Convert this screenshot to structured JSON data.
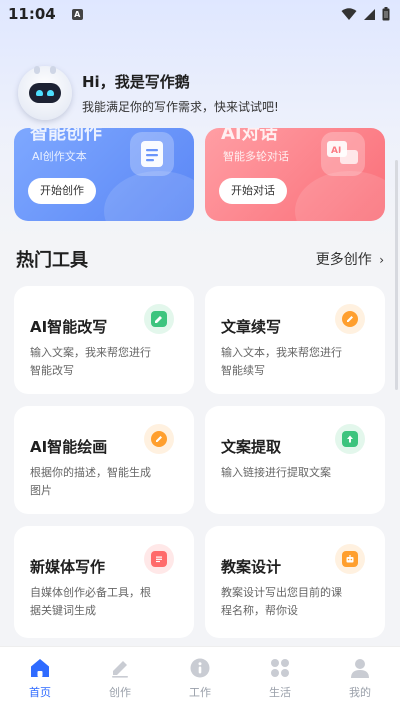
{
  "status_bar": {
    "time": "11:04",
    "notification_glyph": "A"
  },
  "greeting": {
    "title": "Hi，我是写作鹅",
    "subtitle": "我能满足你的写作需求，快来试试吧!"
  },
  "features": [
    {
      "title": "智能创作",
      "subtitle": "AI创作文本",
      "button": "开始创作",
      "icon": "document-icon",
      "color": "#6a95fa"
    },
    {
      "title": "AI对话",
      "subtitle": "智能多轮对话",
      "button": "开始对话",
      "icon": "chat-bubble-icon",
      "color": "#fb7a83"
    }
  ],
  "hot_tools": {
    "title": "热门工具",
    "more": "更多创作",
    "items": [
      {
        "title": "AI智能改写",
        "desc": "输入文案，我来帮您进行智能改写",
        "icon": "edit-icon",
        "color": "#3dc47e"
      },
      {
        "title": "文章续写",
        "desc": "输入文本，我来帮您进行智能续写",
        "icon": "pen-icon",
        "color": "#ff9f2e"
      },
      {
        "title": "AI智能绘画",
        "desc": "根据你的描述，智能生成图片",
        "icon": "brush-icon",
        "color": "#ff9f2e"
      },
      {
        "title": "文案提取",
        "desc": "输入链接进行提取文案",
        "icon": "extract-icon",
        "color": "#3dc47e"
      },
      {
        "title": "新媒体写作",
        "desc": "自媒体创作必备工具，根据关键词生成",
        "icon": "notepad-icon",
        "color": "#ff6b6b"
      },
      {
        "title": "教案设计",
        "desc": "教案设计写出您目前的课程名称，帮你设",
        "icon": "robot-icon",
        "color": "#ff9f2e"
      }
    ]
  },
  "bottom_nav": [
    {
      "label": "首页",
      "icon": "home-icon",
      "active": true
    },
    {
      "label": "创作",
      "icon": "pencil-icon",
      "active": false
    },
    {
      "label": "工作",
      "icon": "info-icon",
      "active": false
    },
    {
      "label": "生活",
      "icon": "grid-icon",
      "active": false
    },
    {
      "label": "我的",
      "icon": "user-icon",
      "active": false
    }
  ],
  "colors": {
    "accent": "#2f6bff",
    "inactive": "#9aa0aa",
    "background": "#f3f4f7"
  }
}
